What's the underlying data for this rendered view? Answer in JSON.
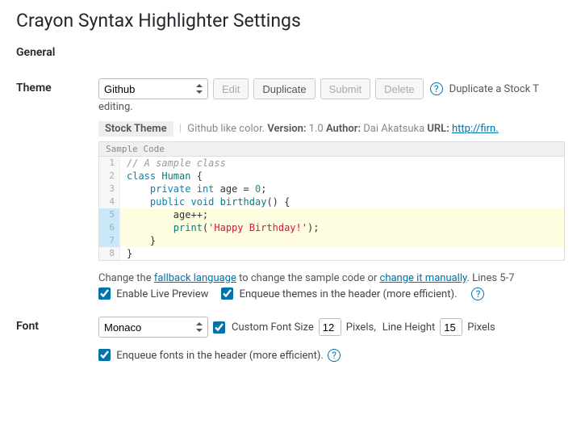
{
  "page": {
    "title": "Crayon Syntax Highlighter Settings",
    "section": "General"
  },
  "theme": {
    "label": "Theme",
    "select": "Github",
    "buttons": {
      "edit": "Edit",
      "duplicate": "Duplicate",
      "submit": "Submit",
      "delete": "Delete"
    },
    "hint": "Duplicate a Stock T",
    "continuation": "editing.",
    "meta": {
      "stock": "Stock Theme",
      "desc": "Github like color.",
      "version_label": "Version:",
      "version": "1.0",
      "author_label": "Author:",
      "author": "Dai Akatsuka",
      "url_label": "URL:",
      "url": "http://firn."
    },
    "code_title": "Sample Code",
    "code": [
      {
        "n": "1",
        "mark": false,
        "tokens": [
          [
            "c-comment",
            "// A sample class"
          ]
        ]
      },
      {
        "n": "2",
        "mark": false,
        "tokens": [
          [
            "c-kw",
            "class"
          ],
          [
            "",
            " "
          ],
          [
            "c-type",
            "Human"
          ],
          [
            "",
            " {"
          ]
        ]
      },
      {
        "n": "3",
        "mark": false,
        "tokens": [
          [
            "",
            "    "
          ],
          [
            "c-kw",
            "private"
          ],
          [
            "",
            " "
          ],
          [
            "c-kw",
            "int"
          ],
          [
            "",
            " age = "
          ],
          [
            "c-num",
            "0"
          ],
          [
            "",
            ";"
          ]
        ]
      },
      {
        "n": "4",
        "mark": false,
        "tokens": [
          [
            "",
            "    "
          ],
          [
            "c-kw",
            "public"
          ],
          [
            "",
            " "
          ],
          [
            "c-kw",
            "void"
          ],
          [
            "",
            " "
          ],
          [
            "c-type",
            "birthday"
          ],
          [
            "",
            "() {"
          ]
        ]
      },
      {
        "n": "5",
        "mark": true,
        "tokens": [
          [
            "",
            "        age++;"
          ]
        ]
      },
      {
        "n": "6",
        "mark": true,
        "tokens": [
          [
            "",
            "        "
          ],
          [
            "c-type",
            "print"
          ],
          [
            "",
            "("
          ],
          [
            "c-str",
            "'Happy Birthday!'"
          ],
          [
            "",
            ");"
          ]
        ]
      },
      {
        "n": "7",
        "mark": true,
        "tokens": [
          [
            "",
            "    }"
          ]
        ]
      },
      {
        "n": "8",
        "mark": false,
        "tokens": [
          [
            "",
            "}"
          ]
        ]
      }
    ],
    "below": {
      "pre": "Change the ",
      "link1": "fallback language",
      "mid": " to change the sample code or ",
      "link2": "change it manually",
      "post": ". Lines 5-7"
    },
    "checks": {
      "live_preview": "Enable Live Preview",
      "enqueue_themes": "Enqueue themes in the header (more efficient)."
    }
  },
  "font": {
    "label": "Font",
    "select": "Monaco",
    "custom_size_label": "Custom Font Size",
    "size": "12",
    "pixels": "Pixels,",
    "line_height_label": "Line Height",
    "line_height": "15",
    "pixels2": "Pixels",
    "enqueue_fonts": "Enqueue fonts in the header (more efficient)."
  },
  "help": "?"
}
